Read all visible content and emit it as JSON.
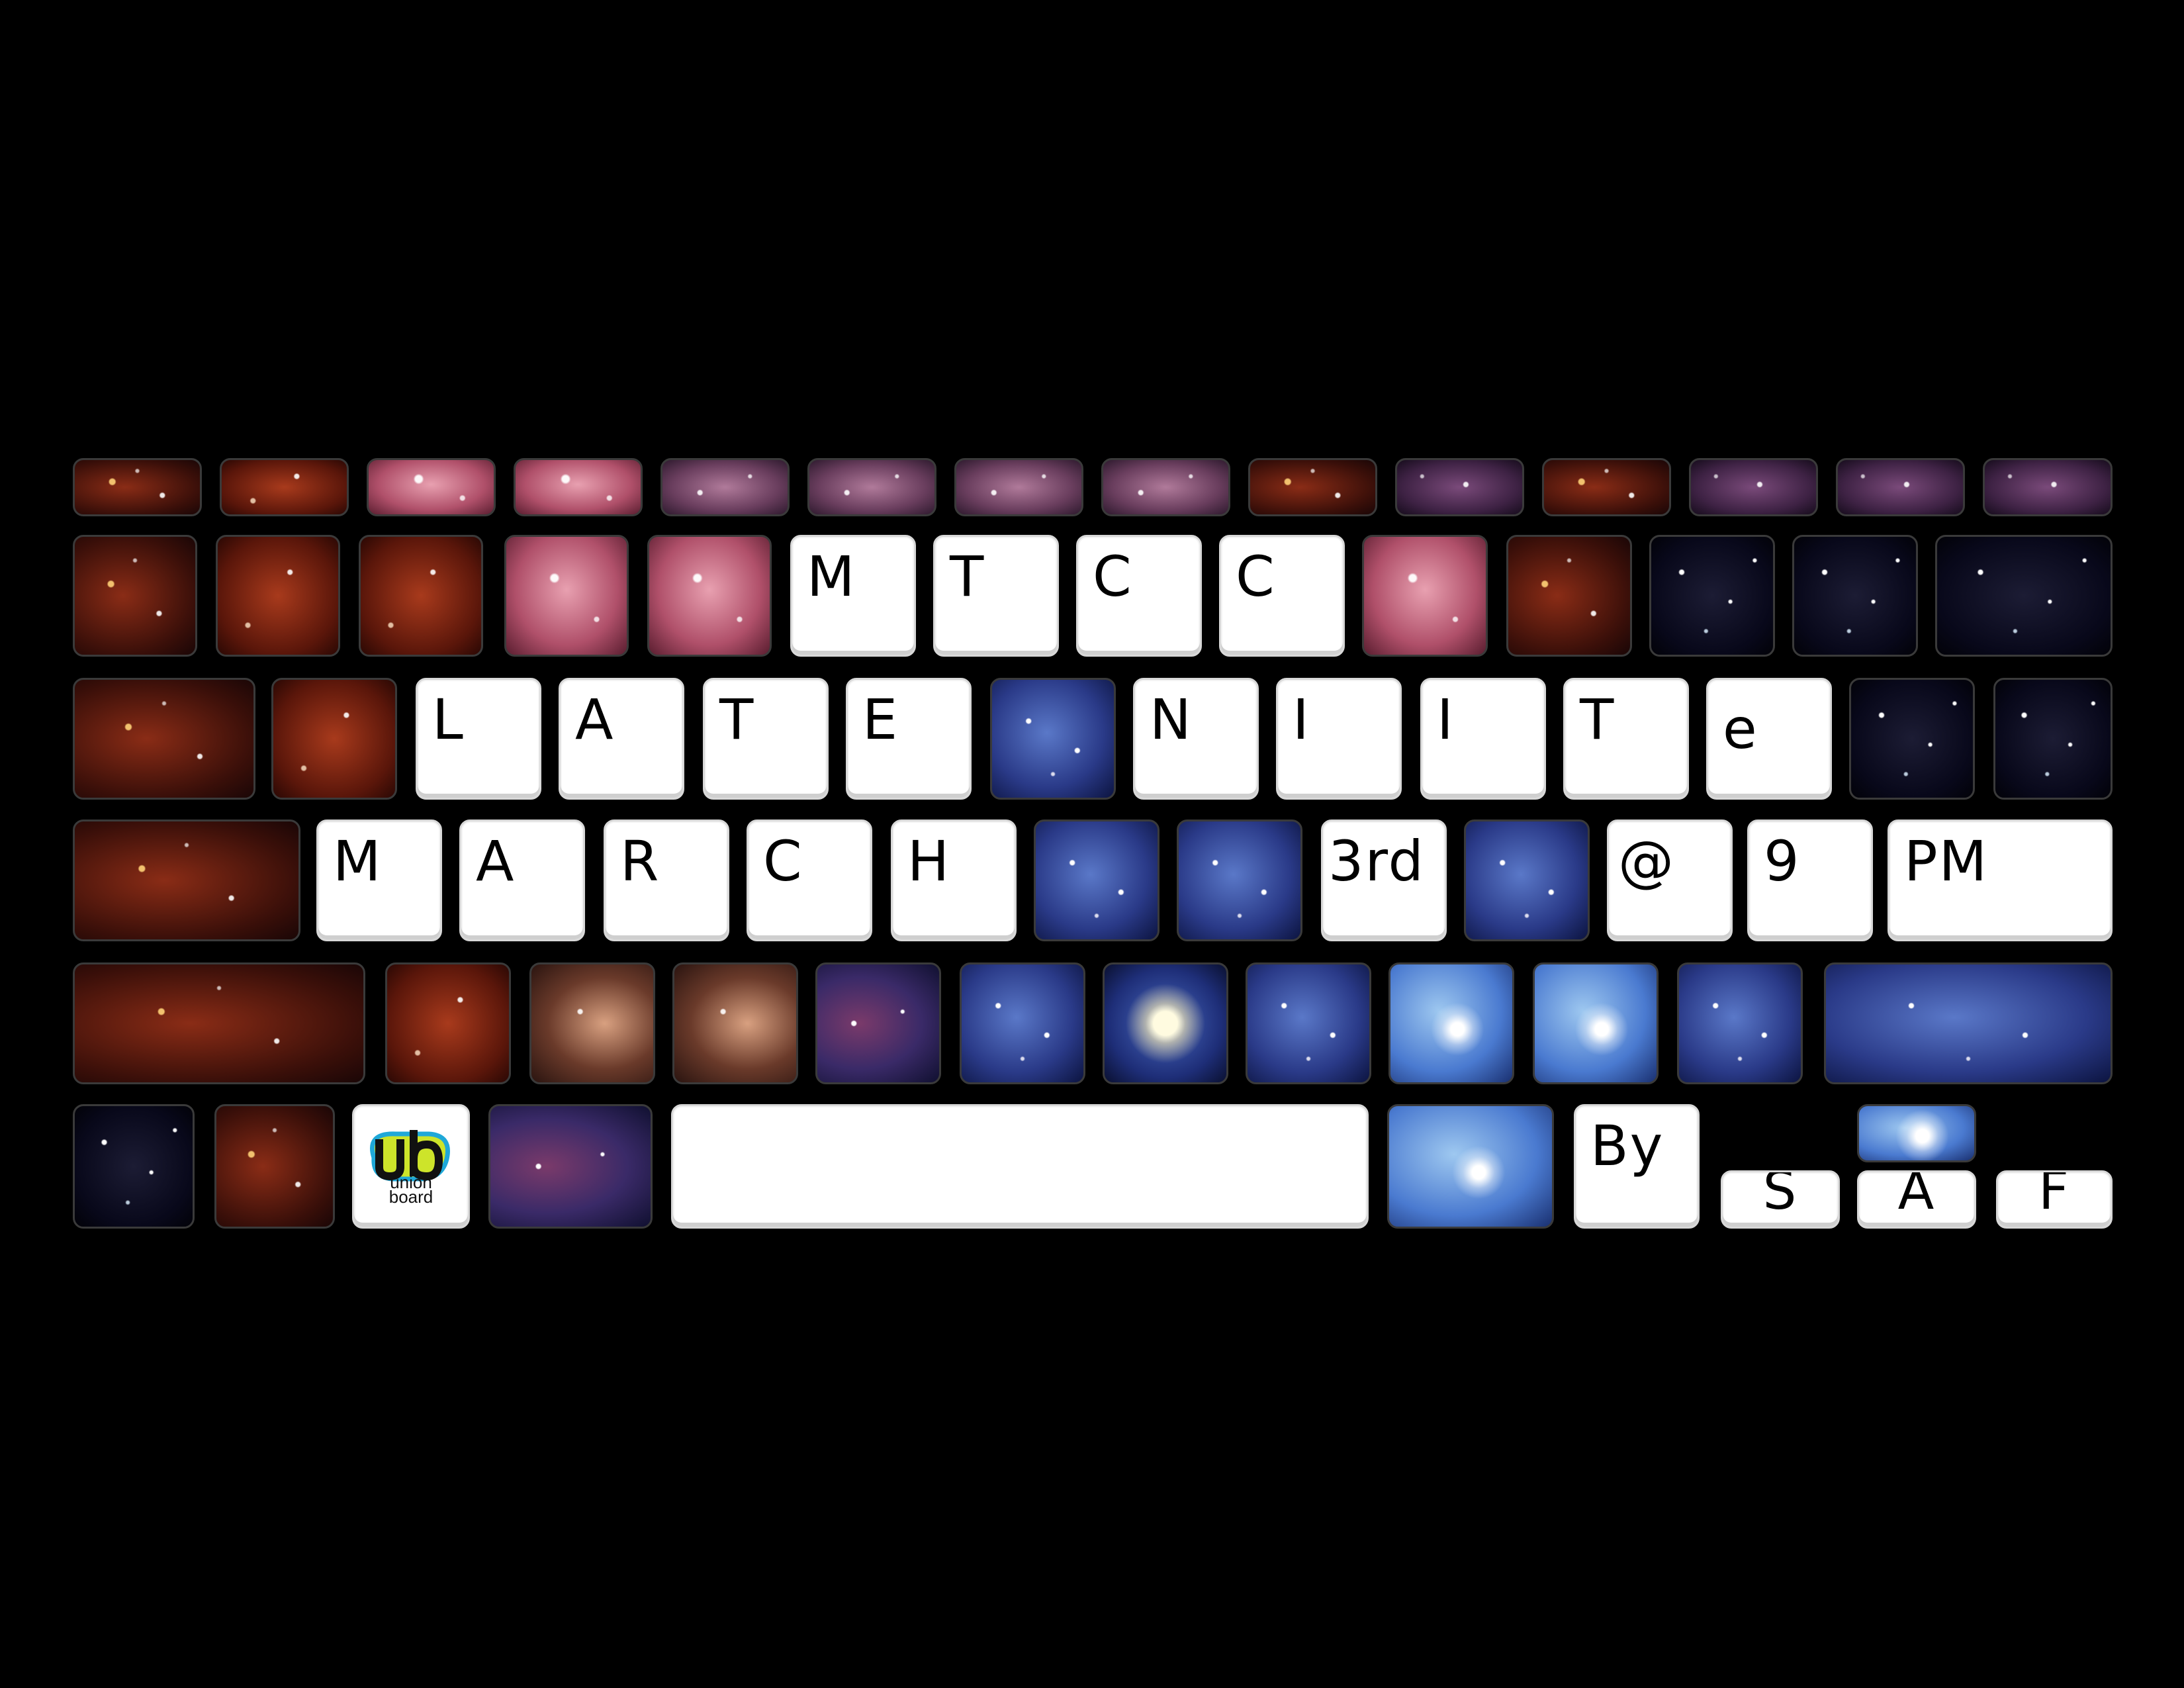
{
  "keyboard": {
    "row2": {
      "m": "M",
      "t": "T",
      "c1": "C",
      "c2": "C"
    },
    "row3": {
      "l": "L",
      "a": "A",
      "t1": "T",
      "e": "E",
      "n": "N",
      "i1": "I",
      "i2": "I",
      "t2": "T",
      "e_small": "e"
    },
    "row4": {
      "m": "M",
      "a": "A",
      "r": "R",
      "c": "C",
      "h": "H",
      "date": "3rd",
      "at": "@",
      "nine": "9",
      "pm": "PM"
    },
    "row6": {
      "by": "By",
      "s": "S",
      "a": "A",
      "f": "F",
      "space": ""
    },
    "logo": {
      "line1": "union",
      "line2": "board"
    }
  }
}
